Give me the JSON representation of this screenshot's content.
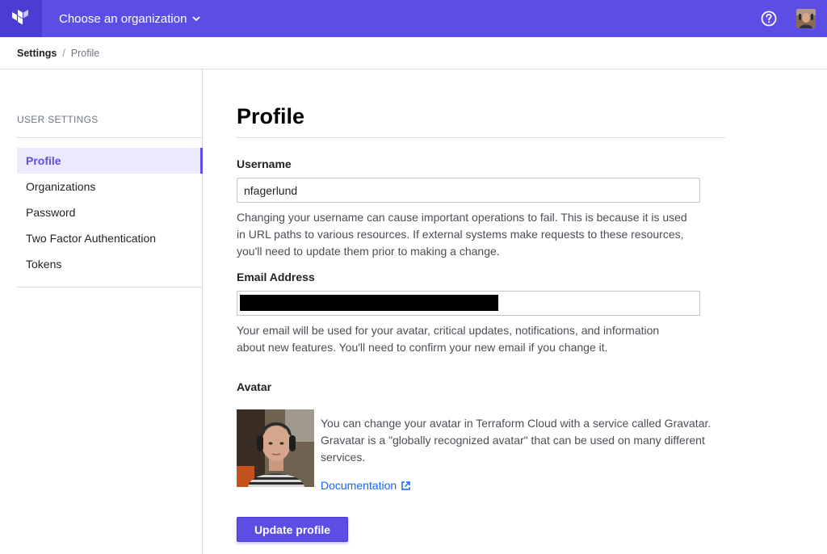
{
  "topnav": {
    "org_selector_label": "Choose an organization",
    "logo_icon": "terraform-logo-icon",
    "help_icon": "help-circle-icon",
    "brand_color": "#5c4ee5"
  },
  "breadcrumb": {
    "parent": "Settings",
    "separator": "/",
    "current": "Profile"
  },
  "sidebar": {
    "heading": "USER SETTINGS",
    "items": [
      {
        "label": "Profile",
        "active": true
      },
      {
        "label": "Organizations",
        "active": false
      },
      {
        "label": "Password",
        "active": false
      },
      {
        "label": "Two Factor Authentication",
        "active": false
      },
      {
        "label": "Tokens",
        "active": false
      }
    ]
  },
  "main": {
    "title": "Profile",
    "username": {
      "label": "Username",
      "value": "nfagerlund",
      "help": "Changing your username can cause important operations to fail. This is because it is used in URL paths to various resources. If external systems make requests to these resources, you'll need to update them prior to making a change."
    },
    "email": {
      "label": "Email Address",
      "value": "",
      "help": "Your email will be used for your avatar, critical updates, notifications, and information about new features. You'll need to confirm your new email if you change it."
    },
    "avatar": {
      "label": "Avatar",
      "description": "You can change your avatar in Terraform Cloud with a service called Gravatar. Gravatar is a \"globally recognized avatar\" that can be used on many different services.",
      "link_label": "Documentation"
    },
    "submit_label": "Update profile"
  }
}
